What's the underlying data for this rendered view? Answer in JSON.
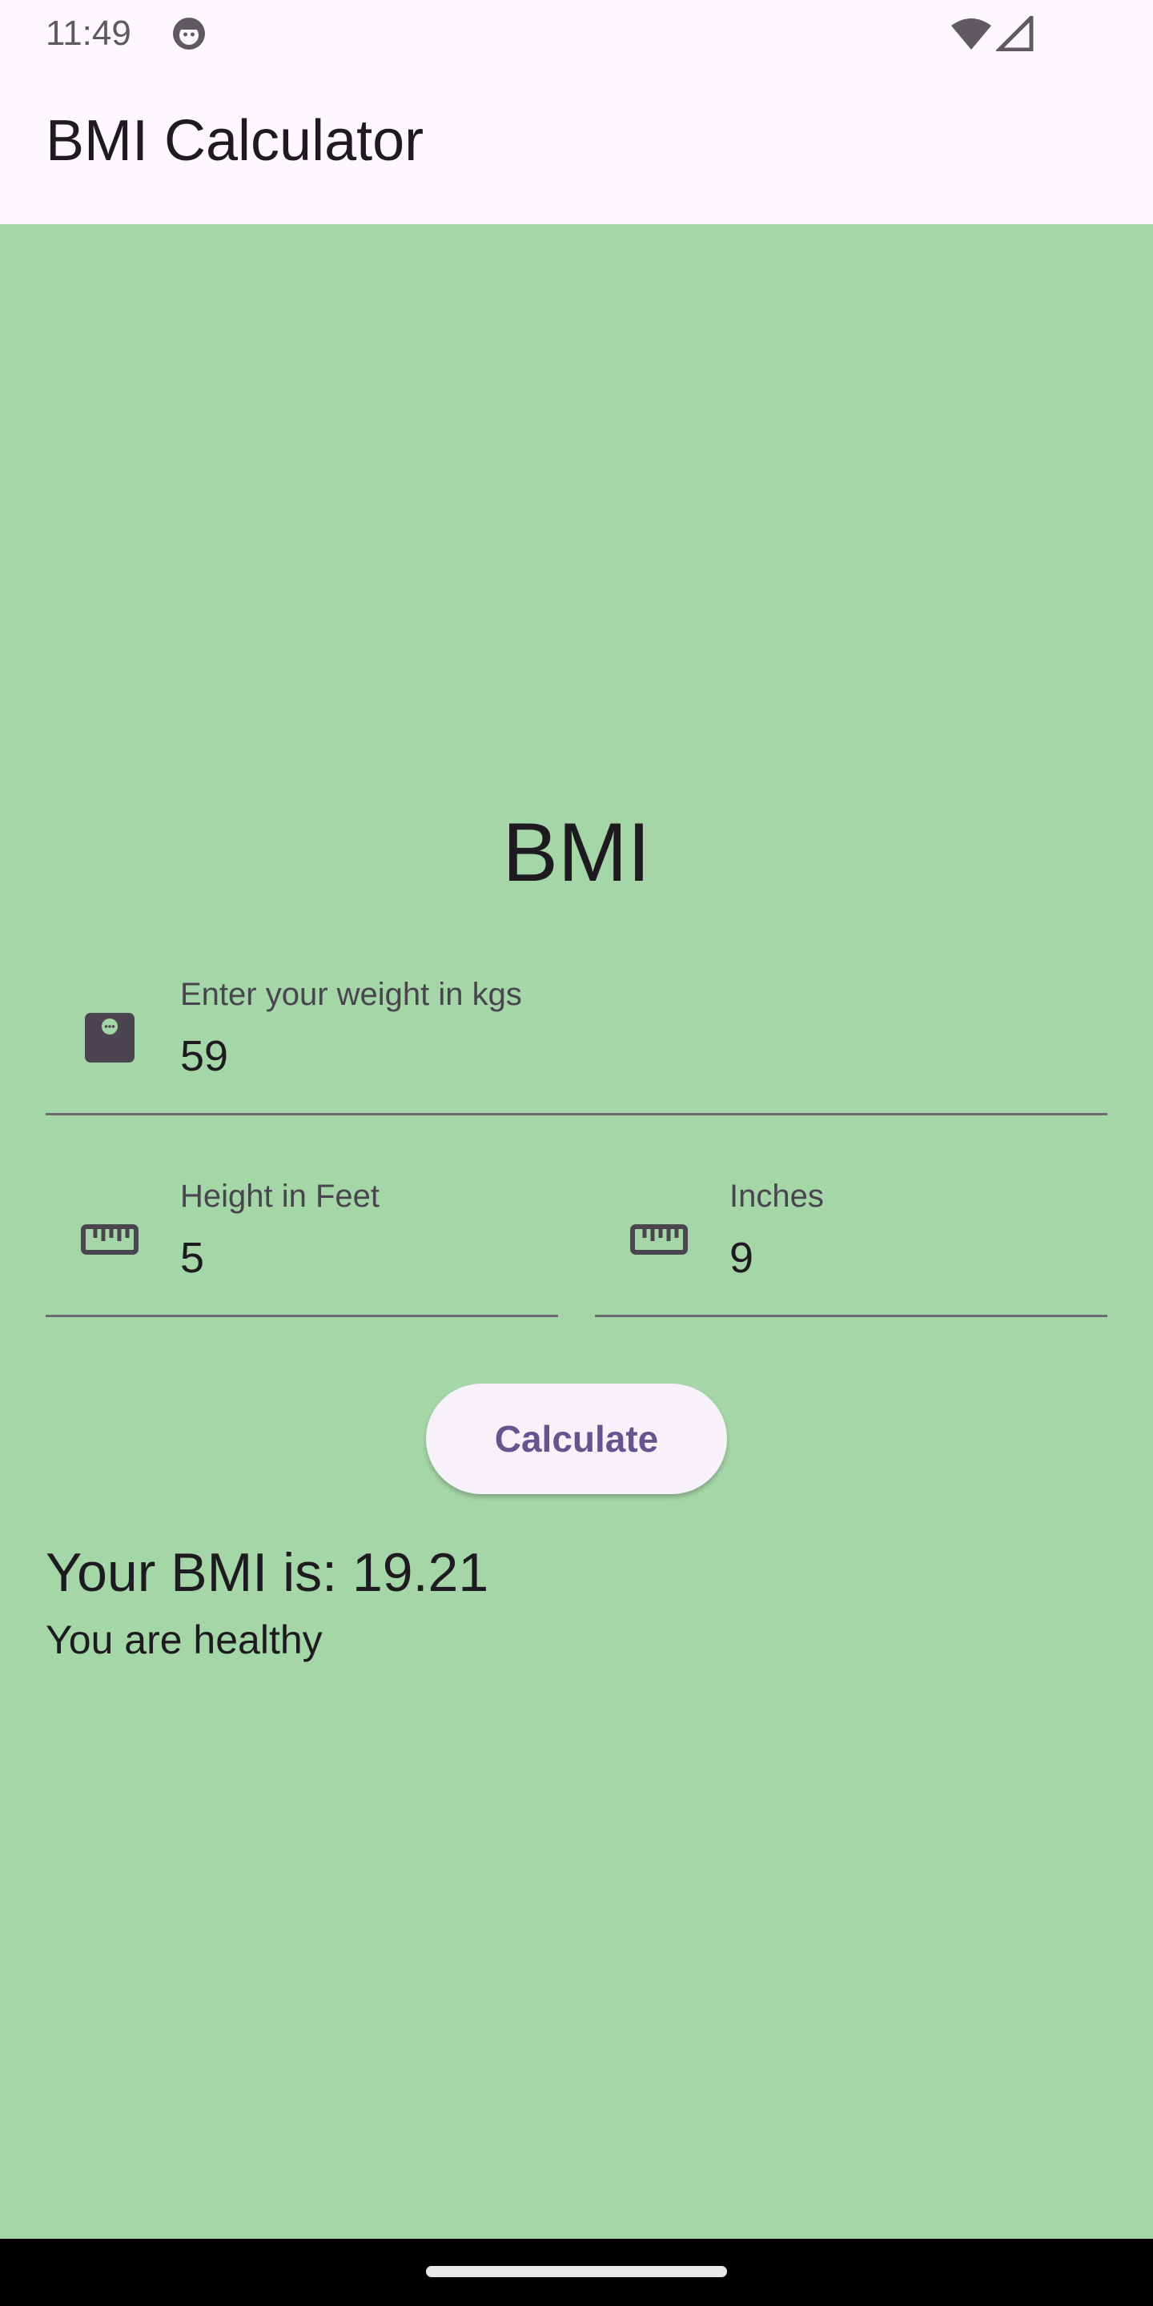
{
  "status_bar": {
    "time": "11:49",
    "icons": [
      "app-notification-icon",
      "wifi-icon",
      "cellular-signal-icon"
    ]
  },
  "app_bar": {
    "title": "BMI Calculator"
  },
  "main": {
    "heading": "BMI",
    "weight_field": {
      "label": "Enter your weight in kgs",
      "value": "59",
      "icon": "scale-icon"
    },
    "feet_field": {
      "label": "Height in Feet",
      "value": "5",
      "icon": "ruler-icon"
    },
    "inches_field": {
      "label": "Inches",
      "value": "9",
      "icon": "ruler-icon"
    },
    "calculate_label": "Calculate",
    "result_text": "Your BMI is: 19.21",
    "status_text": "You are healthy"
  },
  "colors": {
    "background": "#a5d6a7",
    "app_bar": "#fef7ff",
    "button_text": "#65558f",
    "button_bg": "#f7f2fa"
  }
}
